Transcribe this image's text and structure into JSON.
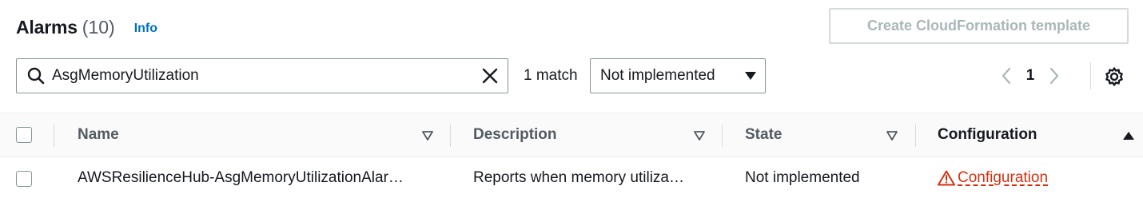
{
  "header": {
    "title": "Alarms",
    "count": "(10)",
    "info_label": "Info"
  },
  "toolbar": {
    "create_cf_label": "Create CloudFormation template"
  },
  "filter": {
    "search_value": "AsgMemoryUtilization",
    "match_text": "1 match",
    "state_selected": "Not implemented"
  },
  "pagination": {
    "current_page": "1"
  },
  "table": {
    "columns": [
      {
        "label": "Name",
        "sort": "none"
      },
      {
        "label": "Description",
        "sort": "none"
      },
      {
        "label": "State",
        "sort": "none"
      },
      {
        "label": "Configuration",
        "sort": "ascending"
      }
    ],
    "rows": [
      {
        "name": "AWSResilienceHub-AsgMemoryUtilizationAlar…",
        "description": "Reports when memory utiliza…",
        "state": "Not implemented",
        "configuration": "Configuration",
        "configuration_status_icon": "warning-icon"
      }
    ]
  },
  "colors": {
    "link": "#0073bb",
    "warning": "#d13212",
    "border": "#879596",
    "disabled_text": "#aab7b8"
  }
}
